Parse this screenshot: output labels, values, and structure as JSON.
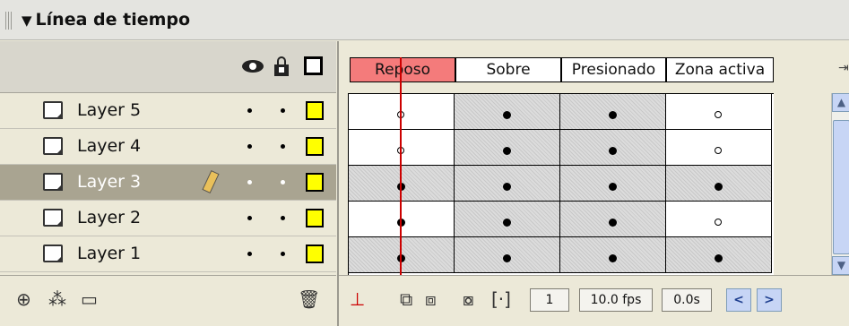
{
  "panel": {
    "title": "Línea de tiempo",
    "collapse_glyph": "▼"
  },
  "header_icons": [
    "eye-icon",
    "lock-icon",
    "outline-icon"
  ],
  "layers": [
    {
      "name": "Layer 5",
      "selected": false
    },
    {
      "name": "Layer 4",
      "selected": false
    },
    {
      "name": "Layer 3",
      "selected": true
    },
    {
      "name": "Layer 2",
      "selected": false
    },
    {
      "name": "Layer 1",
      "selected": false
    }
  ],
  "frame_headers": [
    "Reposo",
    "Sobre",
    "Presionado",
    "Zona activa"
  ],
  "current_frame_header": "Reposo",
  "keyframes": [
    [
      "empty",
      "filled",
      "filled",
      "empty"
    ],
    [
      "empty",
      "filled",
      "filled",
      "empty"
    ],
    [
      "filled",
      "filled",
      "filled",
      "filled"
    ],
    [
      "filled",
      "filled",
      "filled",
      "empty"
    ],
    [
      "filled",
      "filled",
      "filled",
      "filled"
    ]
  ],
  "footer": {
    "current_frame": "1",
    "fps": "10.0 fps",
    "elapsed": "0.0s"
  },
  "colors": {
    "active_frame_header": "#f47b7b",
    "layer_color": "#ffff00",
    "playhead": "#cc0000",
    "selected_layer": "#a9a491"
  }
}
